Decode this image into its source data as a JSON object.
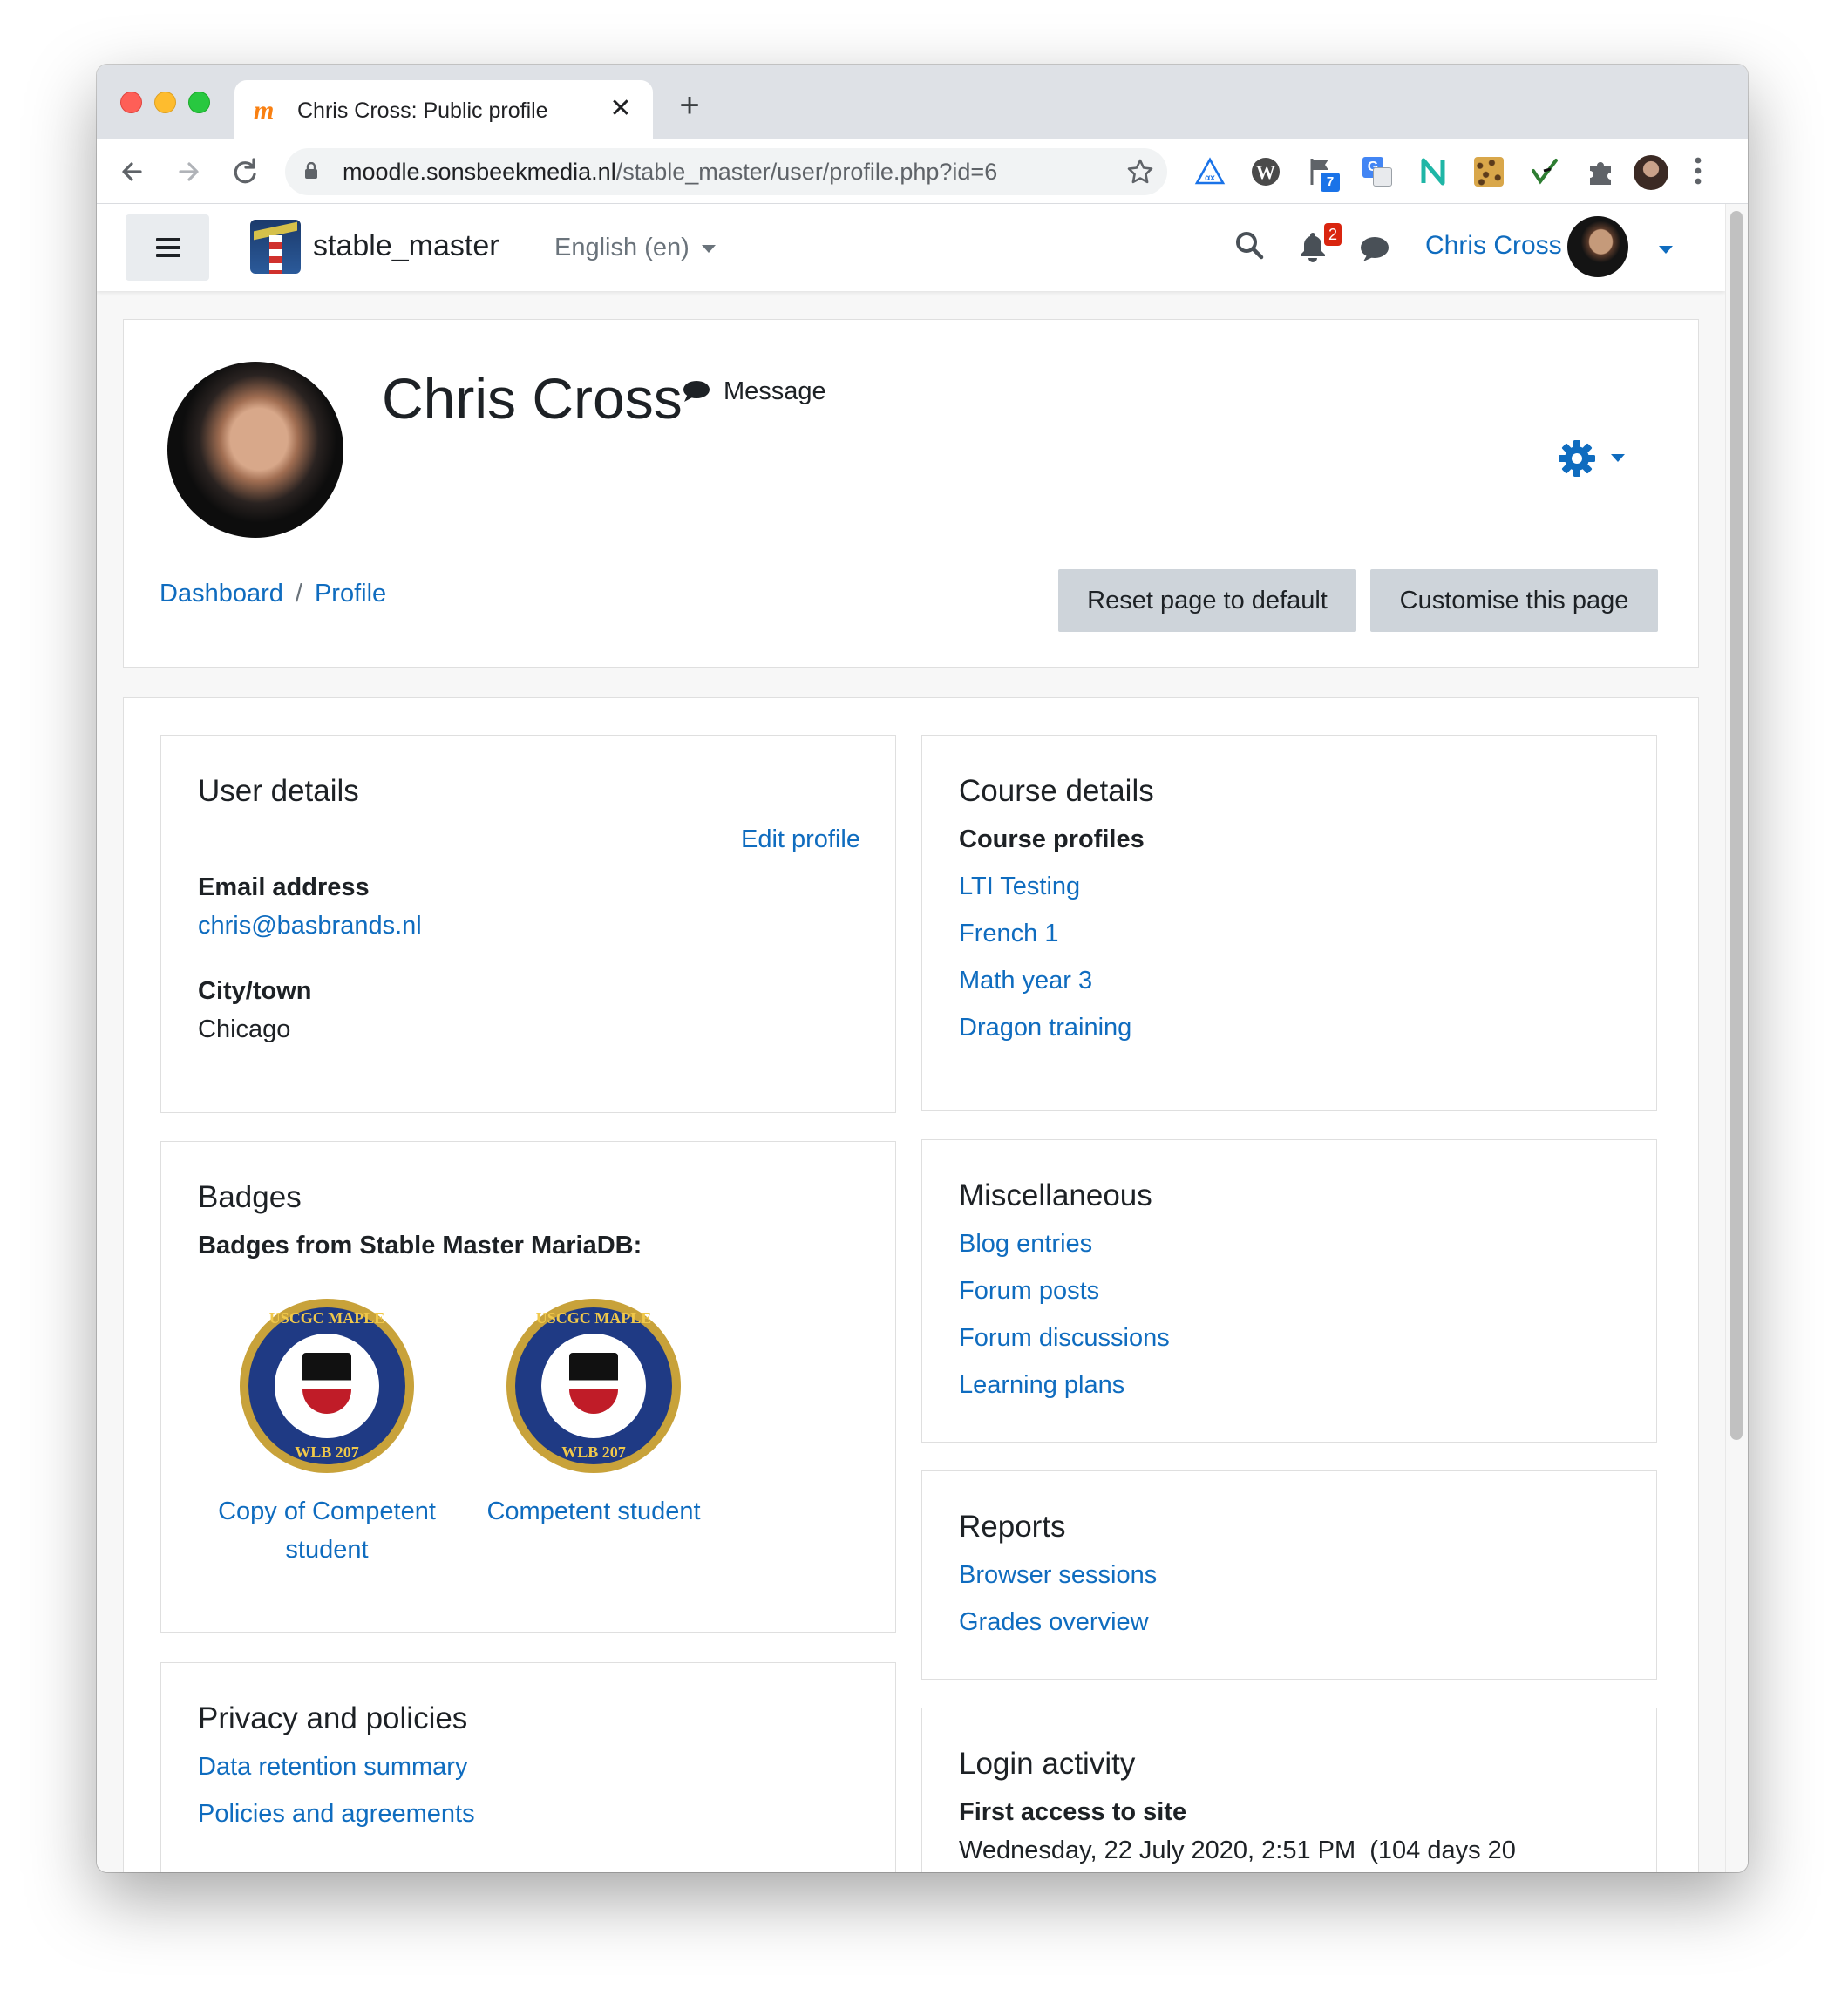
{
  "browser": {
    "tab_title": "Chris Cross: Public profile",
    "favicon_glyph": "m",
    "close_glyph": "✕",
    "newtab_glyph": "+",
    "url_host": "moodle.sonsbeekmedia.nl",
    "url_path": "/stable_master/user/profile.php?id=6",
    "ext_flag_count": "7",
    "ext_translate_glyph": "G"
  },
  "navbar": {
    "site_name": "stable_master",
    "language": "English (en)",
    "notification_count": "2",
    "user_name": "Chris Cross"
  },
  "header": {
    "full_name": "Chris Cross",
    "message_label": "Message",
    "breadcrumb": [
      "Dashboard",
      "Profile"
    ],
    "breadcrumb_sep": "/",
    "reset_button": "Reset page to default",
    "customise_button": "Customise this page"
  },
  "user_details": {
    "title": "User details",
    "edit_profile": "Edit profile",
    "email_label": "Email address",
    "email_value": "chris@basbrands.nl",
    "city_label": "City/town",
    "city_value": "Chicago"
  },
  "course_details": {
    "title": "Course details",
    "profiles_label": "Course profiles",
    "courses": [
      "LTI Testing",
      "French 1",
      "Math year 3",
      "Dragon training"
    ]
  },
  "badges": {
    "title": "Badges",
    "source_label": "Badges from Stable Master MariaDB:",
    "items": [
      {
        "name": "Copy of Competent student",
        "line1": "Copy of Competent",
        "line2": "student",
        "emblem_top": "USCGC MAPLE",
        "emblem_bottom": "WLB 207"
      },
      {
        "name": "Competent student",
        "line1": "Competent student",
        "line2": "",
        "emblem_top": "USCGC MAPLE",
        "emblem_bottom": "WLB 207"
      }
    ]
  },
  "misc": {
    "title": "Miscellaneous",
    "links": [
      "Blog entries",
      "Forum posts",
      "Forum discussions",
      "Learning plans"
    ]
  },
  "reports": {
    "title": "Reports",
    "links": [
      "Browser sessions",
      "Grades overview"
    ]
  },
  "privacy": {
    "title": "Privacy and policies",
    "links": [
      "Data retention summary",
      "Policies and agreements"
    ]
  },
  "login_activity": {
    "title": "Login activity",
    "first_access_label": "First access to site",
    "first_access_value": "Wednesday, 22 July 2020, 2:51 PM  (104 days 20"
  },
  "colors": {
    "link": "#0f6cbf",
    "grey_button": "#ced4da",
    "page_bg": "#f7f7f7",
    "notification_badge": "#d9250f"
  }
}
